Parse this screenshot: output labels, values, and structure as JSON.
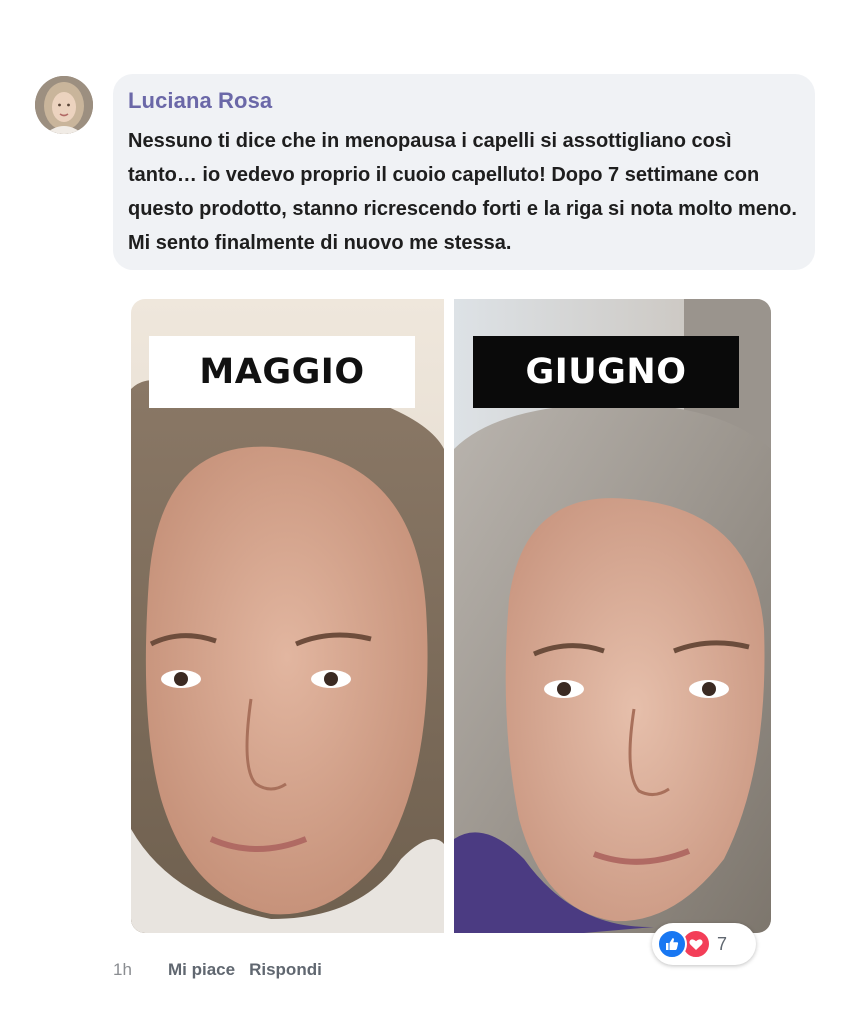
{
  "comment": {
    "author": "Luciana Rosa",
    "text": "Nessuno ti dice che in menopausa i capelli si assottigliano così tanto… io vedevo proprio il cuoio capelluto! Dopo 7 settimane con questo prodotto, stanno ricrescendo forti e la riga si nota molto meno. Mi sento finalmente di nuovo me stessa."
  },
  "photos": {
    "before_label": "MAGGIO",
    "after_label": "GIUGNO"
  },
  "actions": {
    "time": "1h",
    "like_label": "Mi piace",
    "reply_label": "Rispondi"
  },
  "reactions": {
    "icons": [
      "like-icon",
      "love-icon"
    ],
    "count": "7"
  },
  "colors": {
    "bubble": "#f0f2f5",
    "author": "#6b68a8",
    "like": "#1877f2",
    "love": "#f33e58"
  }
}
